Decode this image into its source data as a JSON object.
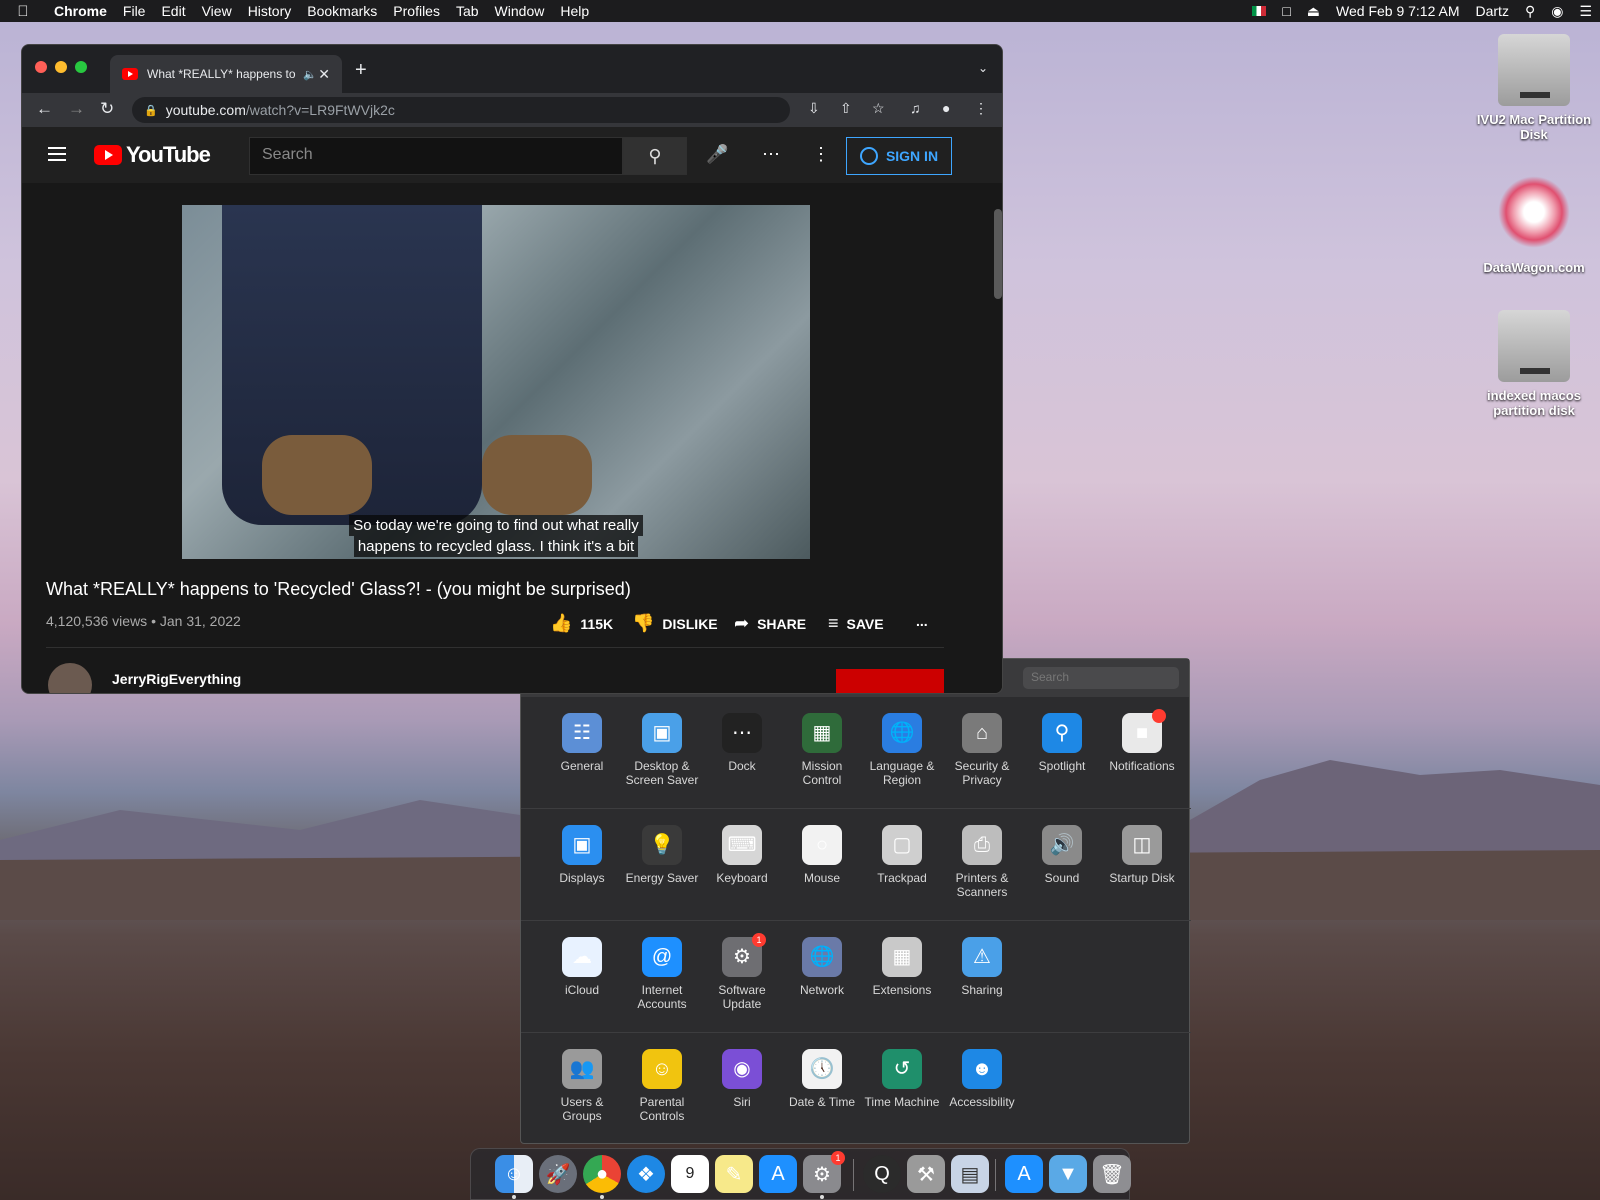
{
  "menubar": {
    "apple": "",
    "items": [
      "Chrome",
      "File",
      "Edit",
      "View",
      "History",
      "Bookmarks",
      "Profiles",
      "Tab",
      "Window",
      "Help"
    ],
    "clock": "Wed Feb 9  7:12 AM",
    "user": "Dartz"
  },
  "desktop": {
    "icons": [
      "IVU2 Mac Partition Disk",
      "DataWagon.com",
      "indexed macos partition disk"
    ]
  },
  "chrome": {
    "tab_title": "What *REALLY* happens to",
    "url_host": "youtube.com",
    "url_path": "/watch?v=LR9FtWVjk2c"
  },
  "youtube": {
    "logo": "YouTube",
    "search_placeholder": "Search",
    "sign_in": "SIGN IN",
    "caption_line1": "So today we're going to find out what really",
    "caption_line2": "happens to recycled glass. I think it's a bit",
    "title": "What *REALLY* happens to 'Recycled' Glass?! - (you might be surprised)",
    "meta": "4,120,536 views • Jan 31, 2022",
    "likes": "115K",
    "dislike": "DISLIKE",
    "share": "SHARE",
    "save": "SAVE",
    "more": "...",
    "channel": "JerryRigEverything"
  },
  "prefs": {
    "search_placeholder": "Search",
    "rows": [
      [
        "General",
        "Desktop & Screen Saver",
        "Dock",
        "Mission Control",
        "Language & Region",
        "Security & Privacy",
        "Spotlight",
        "Notifications"
      ],
      [
        "Displays",
        "Energy Saver",
        "Keyboard",
        "Mouse",
        "Trackpad",
        "Printers & Scanners",
        "Sound",
        "Startup Disk"
      ],
      [
        "iCloud",
        "Internet Accounts",
        "Software Update",
        "Network",
        "Extensions",
        "Sharing"
      ],
      [
        "Users & Groups",
        "Parental Controls",
        "Siri",
        "Date & Time",
        "Time Machine",
        "Accessibility"
      ]
    ],
    "software_update_badge": "1"
  },
  "dock": {
    "calendar_day": "9",
    "prefs_badge": "1"
  }
}
